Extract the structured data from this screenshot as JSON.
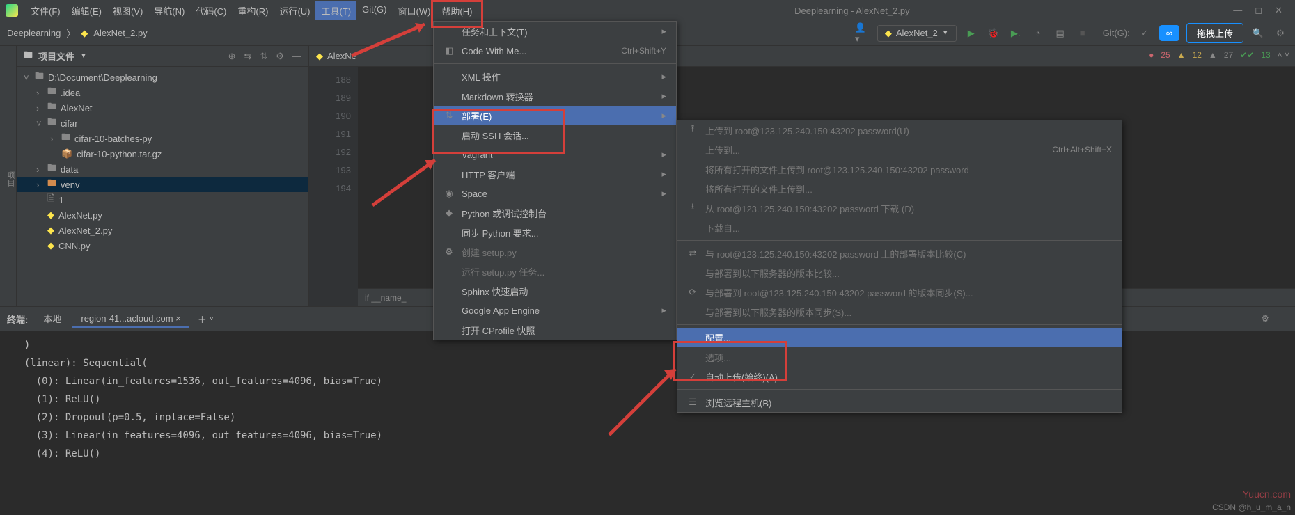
{
  "window_title": "Deeplearning - AlexNet_2.py",
  "menubar": [
    "文件(F)",
    "编辑(E)",
    "视图(V)",
    "导航(N)",
    "代码(C)",
    "重构(R)",
    "运行(U)",
    "工具(T)",
    "Git(G)",
    "窗口(W)",
    "帮助(H)"
  ],
  "menubar_active_index": 7,
  "breadcrumb": {
    "project": "Deeplearning",
    "file": "AlexNet_2.py"
  },
  "toolbar": {
    "run_config": "AlexNet_2",
    "git_label": "Git(G):",
    "upload_label": "拖拽上传"
  },
  "status": {
    "err": "25",
    "warn": "12",
    "weak": "27",
    "ok": "13"
  },
  "project_panel": {
    "title": "项目文件",
    "items": [
      {
        "indent": 0,
        "chev": "v",
        "icon": "fld",
        "label": "D:\\Document\\Deeplearning"
      },
      {
        "indent": 1,
        "chev": ">",
        "icon": "fld",
        "label": ".idea"
      },
      {
        "indent": 1,
        "chev": ">",
        "icon": "fld",
        "label": "AlexNet"
      },
      {
        "indent": 1,
        "chev": "v",
        "icon": "fld",
        "label": "cifar"
      },
      {
        "indent": 2,
        "chev": ">",
        "icon": "fld",
        "label": "cifar-10-batches-py"
      },
      {
        "indent": 2,
        "chev": "",
        "icon": "arc",
        "label": "cifar-10-python.tar.gz"
      },
      {
        "indent": 1,
        "chev": ">",
        "icon": "fld",
        "label": "data"
      },
      {
        "indent": 1,
        "chev": ">",
        "icon": "fldo",
        "label": "venv",
        "sel": true
      },
      {
        "indent": 1,
        "chev": "",
        "icon": "txt",
        "label": "1"
      },
      {
        "indent": 1,
        "chev": "",
        "icon": "py",
        "label": "AlexNet.py"
      },
      {
        "indent": 1,
        "chev": "",
        "icon": "py",
        "label": "AlexNet_2.py"
      },
      {
        "indent": 1,
        "chev": "",
        "icon": "py",
        "label": "CNN.py"
      }
    ]
  },
  "editor": {
    "tab": "AlexNe",
    "lines": [
      "188",
      "189",
      "190",
      "191",
      "192",
      "193",
      "194"
    ],
    "nav": "if __name_"
  },
  "tools_menu": [
    {
      "label": "任务和上下文(T)",
      "arrow": true
    },
    {
      "label": "Code With Me...",
      "shortcut": "Ctrl+Shift+Y",
      "icon": "cwm"
    },
    {
      "sep": true
    },
    {
      "label": "XML 操作",
      "arrow": true
    },
    {
      "label": "Markdown 转换器",
      "arrow": true
    },
    {
      "label": "部署(E)",
      "arrow": true,
      "hov": true,
      "icon": "deploy"
    },
    {
      "label": "启动 SSH 会话..."
    },
    {
      "label": "Vagrant",
      "arrow": true
    },
    {
      "label": "HTTP 客户端",
      "arrow": true
    },
    {
      "label": "Space",
      "icon": "space",
      "arrow": true
    },
    {
      "label": "Python 或调试控制台",
      "icon": "py"
    },
    {
      "label": "同步 Python 要求..."
    },
    {
      "label": "创建 setup.py",
      "disabled": true,
      "icon": "gear"
    },
    {
      "label": "运行 setup.py 任务...",
      "disabled": true
    },
    {
      "label": "Sphinx 快速启动"
    },
    {
      "label": "Google App Engine",
      "arrow": true
    },
    {
      "label": "打开 CProfile 快照"
    }
  ],
  "deploy_menu": [
    {
      "label": "上传到 root@123.125.240.150:43202 password(U)",
      "icon": "up",
      "disabled": true
    },
    {
      "label": "上传到...",
      "shortcut": "Ctrl+Alt+Shift+X",
      "disabled": true
    },
    {
      "label": "将所有打开的文件上传到 root@123.125.240.150:43202 password",
      "disabled": true
    },
    {
      "label": "将所有打开的文件上传到...",
      "disabled": true
    },
    {
      "label": "从 root@123.125.240.150:43202 password 下载 (D)",
      "icon": "dn",
      "disabled": true
    },
    {
      "label": "下载自...",
      "disabled": true
    },
    {
      "sep": true
    },
    {
      "label": "与 root@123.125.240.150:43202 password 上的部署版本比较(C)",
      "icon": "cmp",
      "disabled": true
    },
    {
      "label": "与部署到以下服务器的版本比较...",
      "disabled": true
    },
    {
      "label": "与部署到 root@123.125.240.150:43202 password 的版本同步(S)...",
      "icon": "sync",
      "disabled": true
    },
    {
      "label": "与部署到以下服务器的版本同步(S)...",
      "disabled": true
    },
    {
      "sep": true
    },
    {
      "label": "配置...",
      "hov": true
    },
    {
      "label": "选项...",
      "disabled": true
    },
    {
      "label": "自动上传(始终)(A)",
      "icon": "chk"
    },
    {
      "sep": true
    },
    {
      "label": "浏览远程主机(B)",
      "icon": "list"
    }
  ],
  "terminal": {
    "label": "终端:",
    "tabs": [
      "本地",
      "region-41...acloud.com"
    ],
    "lines": [
      "  )",
      "  (linear): Sequential(",
      "    (0): Linear(in_features=1536, out_features=4096, bias=True)",
      "    (1): ReLU()",
      "    (2): Dropout(p=0.5, inplace=False)",
      "    (3): Linear(in_features=4096, out_features=4096, bias=True)",
      "    (4): ReLU()"
    ]
  },
  "watermark": "Yuucn.com",
  "csdn": "CSDN @h_u_m_a_n"
}
